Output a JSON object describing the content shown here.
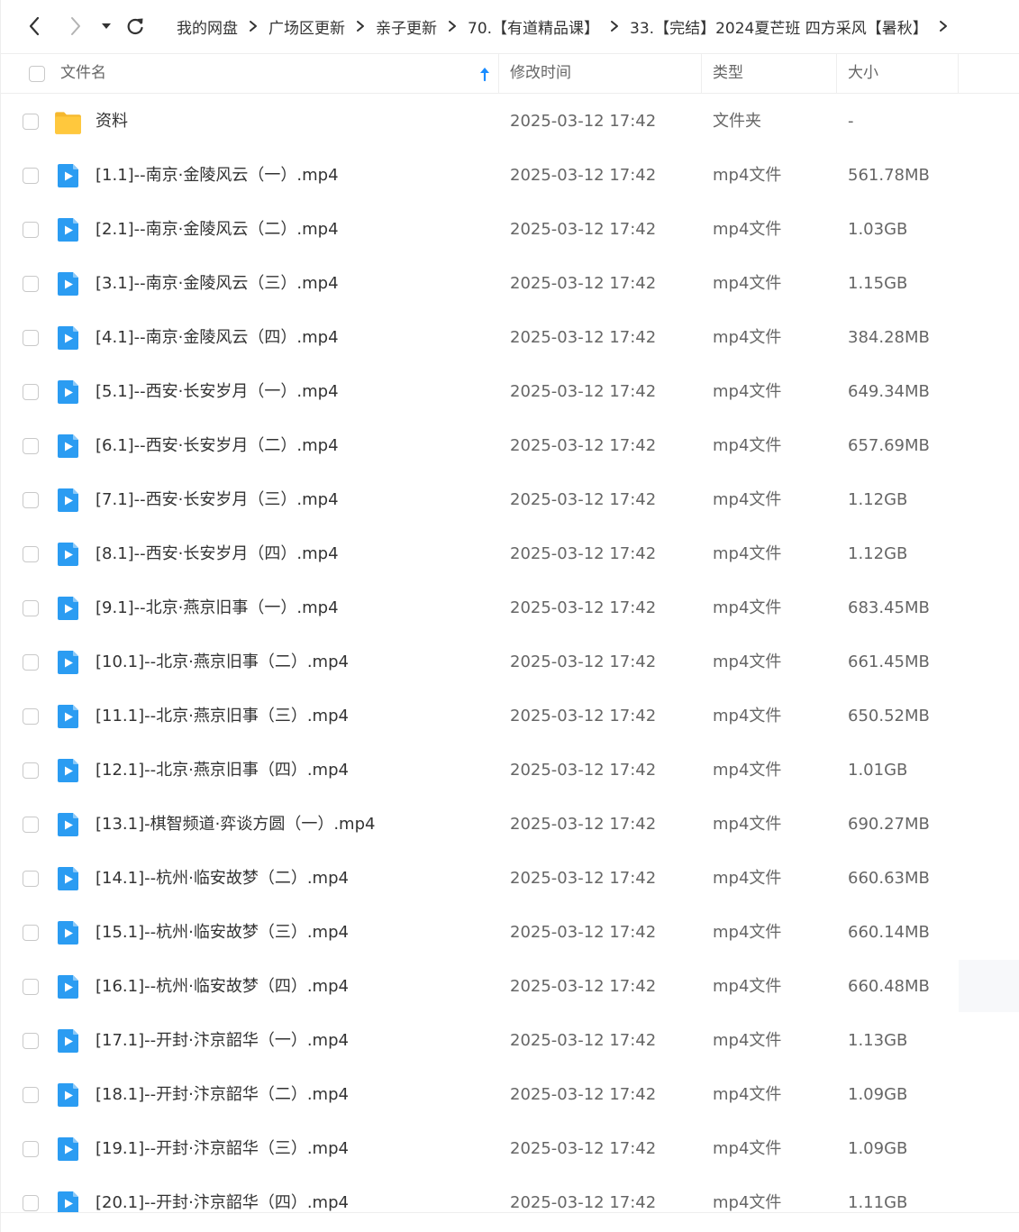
{
  "breadcrumb": [
    "我的网盘",
    "广场区更新",
    "亲子更新",
    "70.【有道精品课】",
    "33.【完结】2024夏芒班 四方采风【暑秋】"
  ],
  "header": {
    "name": "文件名",
    "time": "修改时间",
    "type": "类型",
    "size": "大小"
  },
  "icons": {
    "back": "chevron-left-icon",
    "forward": "chevron-right-icon",
    "history": "caret-down-icon",
    "refresh": "refresh-icon",
    "folder": "folder-icon",
    "video": "video-file-icon",
    "sort": "sort-ascending-icon"
  },
  "colors": {
    "folder": "#ffc83d",
    "video": "#2b9cf2",
    "sort_arrow": "#1a8cff"
  },
  "files": [
    {
      "name": "资料",
      "time": "2025-03-12 17:42",
      "type": "文件夹",
      "size": "-",
      "kind": "folder"
    },
    {
      "name": "[1.1]--南京·金陵风云（一）.mp4",
      "time": "2025-03-12 17:42",
      "type": "mp4文件",
      "size": "561.78MB",
      "kind": "video"
    },
    {
      "name": "[2.1]--南京·金陵风云（二）.mp4",
      "time": "2025-03-12 17:42",
      "type": "mp4文件",
      "size": "1.03GB",
      "kind": "video"
    },
    {
      "name": "[3.1]--南京·金陵风云（三）.mp4",
      "time": "2025-03-12 17:42",
      "type": "mp4文件",
      "size": "1.15GB",
      "kind": "video"
    },
    {
      "name": "[4.1]--南京·金陵风云（四）.mp4",
      "time": "2025-03-12 17:42",
      "type": "mp4文件",
      "size": "384.28MB",
      "kind": "video"
    },
    {
      "name": "[5.1]--西安·长安岁月（一）.mp4",
      "time": "2025-03-12 17:42",
      "type": "mp4文件",
      "size": "649.34MB",
      "kind": "video"
    },
    {
      "name": "[6.1]--西安·长安岁月（二）.mp4",
      "time": "2025-03-12 17:42",
      "type": "mp4文件",
      "size": "657.69MB",
      "kind": "video"
    },
    {
      "name": "[7.1]--西安·长安岁月（三）.mp4",
      "time": "2025-03-12 17:42",
      "type": "mp4文件",
      "size": "1.12GB",
      "kind": "video"
    },
    {
      "name": "[8.1]--西安·长安岁月（四）.mp4",
      "time": "2025-03-12 17:42",
      "type": "mp4文件",
      "size": "1.12GB",
      "kind": "video"
    },
    {
      "name": "[9.1]--北京·燕京旧事（一）.mp4",
      "time": "2025-03-12 17:42",
      "type": "mp4文件",
      "size": "683.45MB",
      "kind": "video"
    },
    {
      "name": "[10.1]--北京·燕京旧事（二）.mp4",
      "time": "2025-03-12 17:42",
      "type": "mp4文件",
      "size": "661.45MB",
      "kind": "video"
    },
    {
      "name": "[11.1]--北京·燕京旧事（三）.mp4",
      "time": "2025-03-12 17:42",
      "type": "mp4文件",
      "size": "650.52MB",
      "kind": "video"
    },
    {
      "name": "[12.1]--北京·燕京旧事（四）.mp4",
      "time": "2025-03-12 17:42",
      "type": "mp4文件",
      "size": "1.01GB",
      "kind": "video"
    },
    {
      "name": "[13.1]-棋智频道·弈谈方圆（一）.mp4",
      "time": "2025-03-12 17:42",
      "type": "mp4文件",
      "size": "690.27MB",
      "kind": "video"
    },
    {
      "name": "[14.1]--杭州·临安故梦（二）.mp4",
      "time": "2025-03-12 17:42",
      "type": "mp4文件",
      "size": "660.63MB",
      "kind": "video"
    },
    {
      "name": "[15.1]--杭州·临安故梦（三）.mp4",
      "time": "2025-03-12 17:42",
      "type": "mp4文件",
      "size": "660.14MB",
      "kind": "video"
    },
    {
      "name": "[16.1]--杭州·临安故梦（四）.mp4",
      "time": "2025-03-12 17:42",
      "type": "mp4文件",
      "size": "660.48MB",
      "kind": "video"
    },
    {
      "name": "[17.1]--开封·汴京韶华（一）.mp4",
      "time": "2025-03-12 17:42",
      "type": "mp4文件",
      "size": "1.13GB",
      "kind": "video"
    },
    {
      "name": "[18.1]--开封·汴京韶华（二）.mp4",
      "time": "2025-03-12 17:42",
      "type": "mp4文件",
      "size": "1.09GB",
      "kind": "video"
    },
    {
      "name": "[19.1]--开封·汴京韶华（三）.mp4",
      "time": "2025-03-12 17:42",
      "type": "mp4文件",
      "size": "1.09GB",
      "kind": "video"
    },
    {
      "name": "[20.1]--开封·汴京韶华（四）.mp4",
      "time": "2025-03-12 17:42",
      "type": "mp4文件",
      "size": "1.11GB",
      "kind": "video"
    }
  ]
}
